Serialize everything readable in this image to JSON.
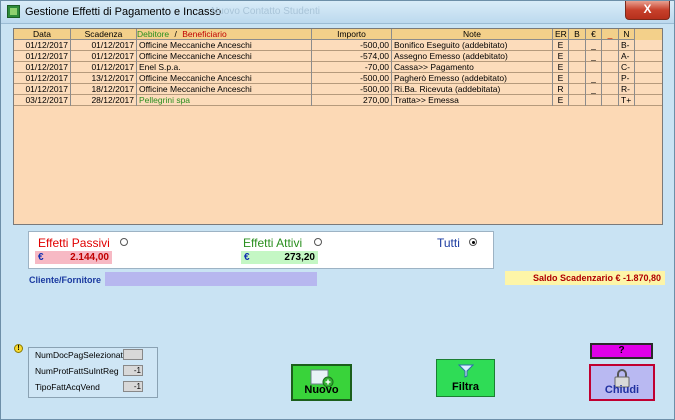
{
  "window": {
    "title": "Gestione Effetti di Pagamento e Incasso",
    "ghost_title": "Nuovo Contatto   Studenti",
    "close_label": "X"
  },
  "grid": {
    "headers": {
      "data": "Data",
      "scadenza": "Scadenza",
      "debitore": "Debitore",
      "slash": "/",
      "beneficiario": "Beneficiario",
      "importo": "Importo",
      "note": "Note",
      "er": "ER",
      "b": "B",
      "euro": "€",
      "dash": "_",
      "n": "N"
    },
    "rows": [
      {
        "data": "01/12/2017",
        "scadenza": "01/12/2017",
        "nome": "Officine Meccaniche Anceschi",
        "importo": "-500,00",
        "note": "Bonifico Eseguito (addebitato)",
        "er": "E",
        "b": "",
        "euro": "_",
        "dash": "",
        "n": "B-",
        "green": false
      },
      {
        "data": "01/12/2017",
        "scadenza": "01/12/2017",
        "nome": "Officine Meccaniche Anceschi",
        "importo": "-574,00",
        "note": "Assegno Emesso (addebitato)",
        "er": "E",
        "b": "",
        "euro": "_",
        "dash": "",
        "n": "A-",
        "green": false
      },
      {
        "data": "01/12/2017",
        "scadenza": "01/12/2017",
        "nome": "Enel S.p.a.",
        "importo": "-70,00",
        "note": "Cassa>> Pagamento",
        "er": "E",
        "b": "",
        "euro": "",
        "dash": "",
        "n": "C-",
        "green": false
      },
      {
        "data": "01/12/2017",
        "scadenza": "13/12/2017",
        "nome": "Officine Meccaniche Anceschi",
        "importo": "-500,00",
        "note": "Pagherò Emesso (addebitato)",
        "er": "E",
        "b": "",
        "euro": "_",
        "dash": "",
        "n": "P-",
        "green": false
      },
      {
        "data": "01/12/2017",
        "scadenza": "18/12/2017",
        "nome": "Officine Meccaniche Anceschi",
        "importo": "-500,00",
        "note": "Ri.Ba. Ricevuta (addebitata)",
        "er": "R",
        "b": "",
        "euro": "_",
        "dash": "",
        "n": "R-",
        "green": false
      },
      {
        "data": "03/12/2017",
        "scadenza": "28/12/2017",
        "nome": "Pellegrini spa",
        "importo": "270,00",
        "note": "Tratta>> Emessa",
        "er": "E",
        "b": "",
        "euro": "",
        "dash": "",
        "n": "T+",
        "green": true
      }
    ]
  },
  "filter": {
    "passivi": {
      "label": "Effetti Passivi",
      "currency": "€",
      "amount": "2.144,00",
      "color": "#e00000",
      "box_color": "#f7b9c4"
    },
    "attivi": {
      "label": "Effetti Attivi",
      "currency": "€",
      "amount": "273,20",
      "color": "#2a8f1f",
      "box_color": "#c4f7c4"
    },
    "tutti": {
      "label": "Tutti",
      "selected": true
    }
  },
  "cliente": {
    "label": "Cliente/Fornitore",
    "value": ""
  },
  "saldo": {
    "text": "Saldo Scadenzario  € -1.870,80"
  },
  "info": {
    "icon": "!",
    "items": [
      {
        "label": "NumDocPagSelezionato",
        "value": ""
      },
      {
        "label": "NumProtFattSuIntReg",
        "value": "-1"
      },
      {
        "label": "TipoFattAcqVend",
        "value": "-1"
      }
    ]
  },
  "buttons": {
    "nuovo": "Nuovo",
    "filtra": "Filtra",
    "help": "?",
    "chiudi": "Chiudi"
  }
}
